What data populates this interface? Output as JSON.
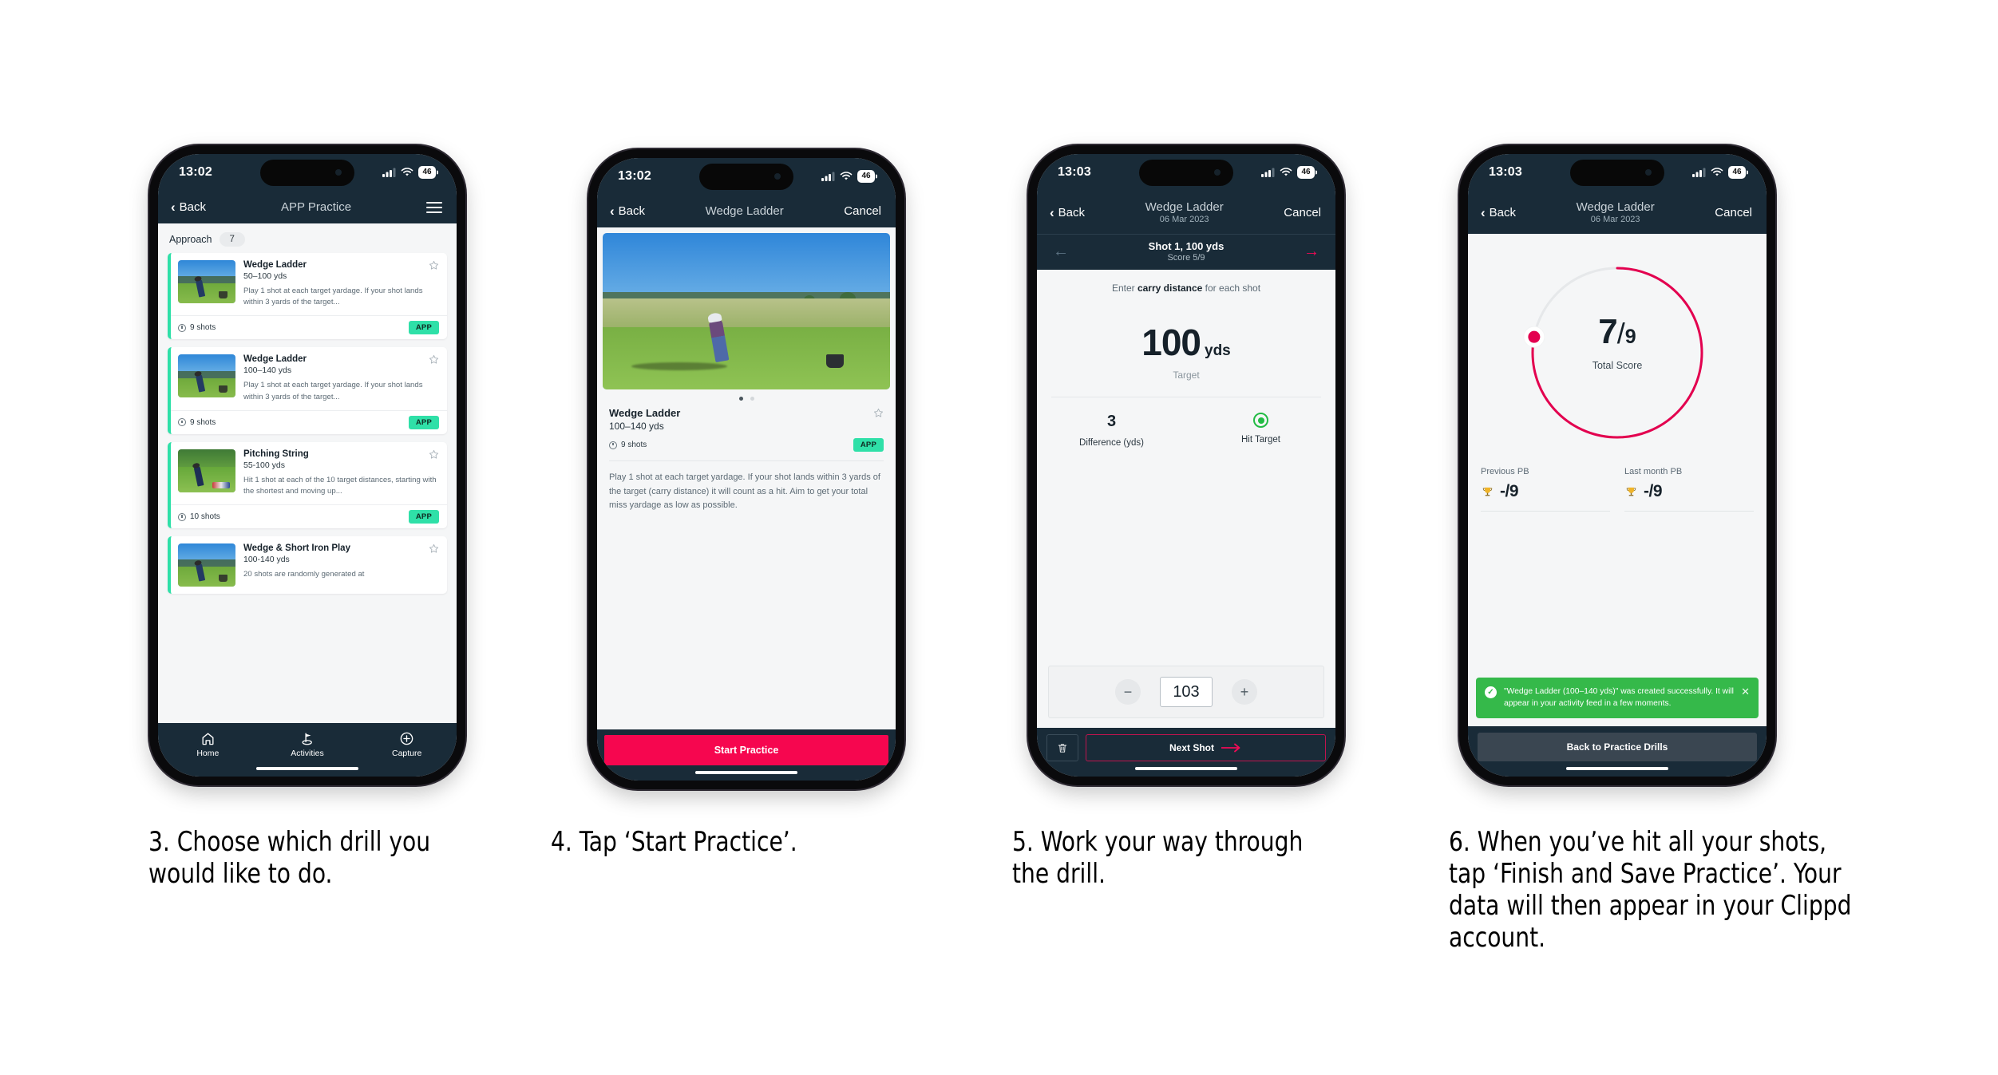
{
  "phones": [
    {
      "id": "phone-1",
      "status": {
        "time": "13:02",
        "battery": "46"
      },
      "nav": {
        "back": "Back",
        "title": "APP Practice",
        "menu_icon": "hamburger-icon"
      },
      "section": {
        "label": "Approach",
        "count": "7"
      },
      "cards": [
        {
          "title": "Wedge Ladder",
          "sub": "50–100 yds",
          "desc": "Play 1 shot at each target yardage. If your shot lands within 3 yards of the target...",
          "shots": "9 shots",
          "tag": "APP"
        },
        {
          "title": "Wedge Ladder",
          "sub": "100–140 yds",
          "desc": "Play 1 shot at each target yardage. If your shot lands within 3 yards of the target...",
          "shots": "9 shots",
          "tag": "APP"
        },
        {
          "title": "Pitching String",
          "sub": "55-100 yds",
          "desc": "Hit 1 shot at each of the 10 target distances, starting with the shortest and moving up...",
          "shots": "10 shots",
          "tag": "APP"
        },
        {
          "title": "Wedge & Short Iron Play",
          "sub": "100-140 yds",
          "desc": "20 shots are randomly generated at",
          "shots": "",
          "tag": ""
        }
      ],
      "tabs": [
        {
          "label": "Home",
          "icon": "home-icon"
        },
        {
          "label": "Activities",
          "icon": "golf-flag-icon"
        },
        {
          "label": "Capture",
          "icon": "plus-circle-icon"
        }
      ]
    },
    {
      "id": "phone-2",
      "status": {
        "time": "13:02",
        "battery": "46"
      },
      "nav": {
        "back": "Back",
        "title": "Wedge Ladder",
        "cancel": "Cancel"
      },
      "detail": {
        "title": "Wedge Ladder",
        "sub": "100–140 yds",
        "shots": "9 shots",
        "tag": "APP",
        "desc": "Play 1 shot at each target yardage. If your shot lands within 3 yards of the target (carry distance) it will count as a hit. Aim to get your total miss yardage as low as possible."
      },
      "cta": "Start Practice"
    },
    {
      "id": "phone-3",
      "status": {
        "time": "13:03",
        "battery": "46"
      },
      "nav": {
        "back": "Back",
        "title": "Wedge Ladder",
        "date": "06 Mar 2023",
        "cancel": "Cancel"
      },
      "shotbar": {
        "title": "Shot 1, 100 yds",
        "score": "Score 5/9",
        "prev_icon": "arrow-left-icon",
        "next_icon": "arrow-right-icon"
      },
      "prompt_pre": "Enter ",
      "prompt_bold": "carry distance",
      "prompt_post": " for each shot",
      "target": {
        "value": "100",
        "unit": "yds",
        "label": "Target"
      },
      "stats": [
        {
          "value": "3",
          "label": "Difference (yds)"
        },
        {
          "value": "",
          "label": "Hit Target",
          "icon": "hit-target-icon"
        }
      ],
      "stepper": {
        "minus": "−",
        "value": "103",
        "plus": "+"
      },
      "footer": {
        "delete_icon": "trash-icon",
        "next": "Next Shot"
      }
    },
    {
      "id": "phone-4",
      "status": {
        "time": "13:03",
        "battery": "46"
      },
      "nav": {
        "back": "Back",
        "title": "Wedge Ladder",
        "date": "06 Mar 2023",
        "cancel": "Cancel"
      },
      "score": {
        "value": "7",
        "slash": "/",
        "denominator": "9",
        "label": "Total Score",
        "progress_pct": 78
      },
      "pbs": [
        {
          "title": "Previous PB",
          "value": "-/9",
          "icon": "trophy-icon"
        },
        {
          "title": "Last month PB",
          "value": "-/9",
          "icon": "trophy-icon"
        }
      ],
      "toast": {
        "message": "\"Wedge Ladder (100–140 yds)\" was created successfully. It will appear in your activity feed in a few moments.",
        "check_icon": "check-circle-icon",
        "close_icon": "close-icon"
      },
      "footer": {
        "button": "Back to Practice Drills"
      }
    }
  ],
  "captions": [
    "3. Choose which drill you would like to do.",
    "4. Tap ‘Start Practice’.",
    "5. Work your way through the drill.",
    "6. When you’ve hit all your shots, tap ‘Finish and Save Practice’. Your data will then appear in your Clippd account."
  ],
  "colors": {
    "nav_dark": "#192b38",
    "accent_pink": "#f6064f",
    "accent_teal": "#2fe0a8",
    "toast_green": "#35b94a",
    "trophy_gold": "#f0b429"
  }
}
